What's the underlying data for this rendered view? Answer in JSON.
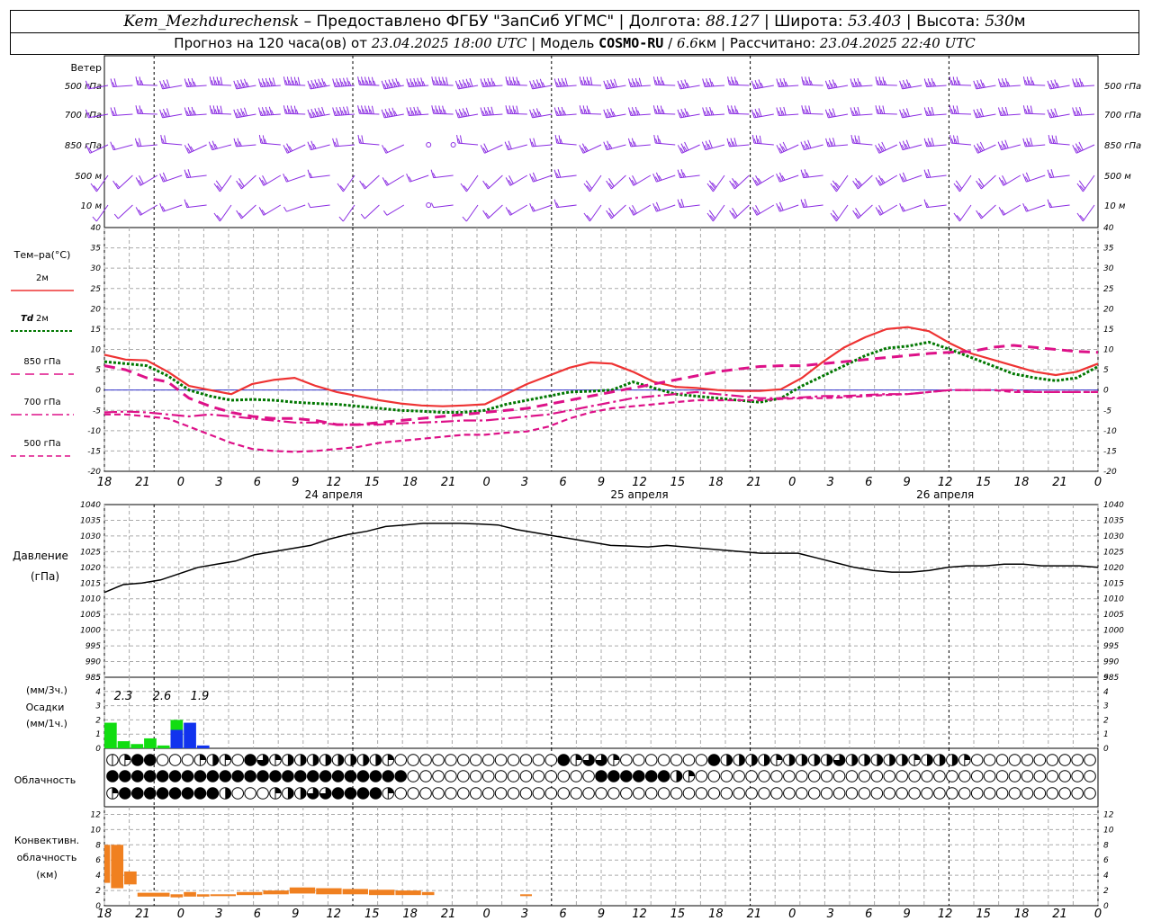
{
  "header": {
    "station": "Kem_Mezhdurechensk",
    "dash": "–",
    "provider": "Предоставлено ФГБУ \"ЗапСиб УГМС\"",
    "sep": "|",
    "lon_label": "Долгота:",
    "lon_value": "88.127",
    "lat_label": "Широта:",
    "lat_value": "53.403",
    "alt_label": "Высота:",
    "alt_value": "530",
    "alt_unit": "м",
    "forecast_prefix": "Прогноз на 120 часа(ов) от",
    "forecast_from": "23.04.2025 18:00 UTC",
    "model_label": "Модель",
    "model_name": "COSMO-RU",
    "model_res": "6.6",
    "model_res_unit": "км",
    "computed_label": "Рассчитано:",
    "computed_at": "23.04.2025 22:40 UTC"
  },
  "colors": {
    "t2m": "#ee3333",
    "td2m": "#007700",
    "upper": "#dd1188",
    "wind": "#8a2be2",
    "pressure": "#000000",
    "precip_green": "#11dd11",
    "precip_blue": "#1133ee",
    "convective": "#f08020",
    "zero_line": "#3333cc"
  },
  "time_axis": {
    "hour_labels": [
      "18",
      "21",
      "0",
      "3",
      "6",
      "9",
      "12",
      "15",
      "18",
      "21",
      "0",
      "3",
      "6",
      "9",
      "12",
      "15",
      "18",
      "21",
      "0",
      "3",
      "6",
      "9",
      "12",
      "15",
      "18",
      "21",
      "0"
    ],
    "date_labels": [
      "24 апреля",
      "25 апреля",
      "26 апреля"
    ]
  },
  "wind_panel": {
    "title": "Ветер",
    "levels": [
      "500 гПа",
      "700 гПа",
      "850 гПа",
      "500 м",
      "10 м"
    ]
  },
  "temp_panel": {
    "title": "Тем–ра(°С)",
    "legend": [
      {
        "label": "2м",
        "style": "solid"
      },
      {
        "label_td": "Td",
        "label": "2м",
        "style": "dotted"
      },
      {
        "label": "850 гПа",
        "style": "dashed"
      },
      {
        "label": "700 гПа",
        "style": "dashdot"
      },
      {
        "label": "500 гПа",
        "style": "shortdash"
      }
    ]
  },
  "pressure_panel": {
    "title": "Давление",
    "unit": "(гПа)"
  },
  "precip_panel": {
    "unit3h": "(мм/3ч.)",
    "title": "Осадки",
    "unit1h": "(мм/1ч.)",
    "totals": [
      "2.3",
      "2.6",
      "1.9"
    ]
  },
  "cloud_panel": {
    "title": "Облачность",
    "rows": [
      "01445551210431222222221000000000000041331000000042222122223222221222100000000000000000000000000000000000",
      "44444444444444444444444400000000000000044444421000000000000000000000000000000000000000000000000000000",
      "14444444420001223344441000000000000000000000000000000000000000000000000000000000000000000000000000000"
    ]
  },
  "conv_panel": {
    "title1": "Конвективн.",
    "title2": "облачность",
    "unit": "(км)"
  },
  "chart_data": [
    {
      "type": "line",
      "title": "Тем–ра(°С)",
      "ylim": [
        -20,
        40
      ],
      "x_hours_from_start": [
        0,
        1,
        3,
        6,
        9,
        12,
        15,
        18,
        21,
        24,
        27,
        30,
        33,
        36,
        39,
        42,
        45,
        48,
        51,
        54,
        57,
        60,
        63,
        66,
        69,
        72,
        75,
        78,
        81,
        84,
        87,
        90,
        93,
        96,
        99,
        102,
        105,
        108,
        111,
        114,
        117,
        120
      ],
      "series": [
        {
          "name": "2м",
          "values": [
            8.7,
            7.5,
            7.3,
            4.5,
            1,
            0,
            -1,
            1.5,
            2.5,
            3,
            1,
            -0.5,
            -1.5,
            -2.5,
            -3.3,
            -3.8,
            -4,
            -3.8,
            -3.5,
            -1,
            1.5,
            3.5,
            5.5,
            6.8,
            6.5,
            4.5,
            2,
            0.8,
            0.5,
            0,
            -0.2,
            -0.2,
            0.2,
            3,
            7,
            10.5,
            13,
            15,
            15.5,
            14.5,
            11.5,
            9,
            7.5,
            6,
            4.5,
            3.7,
            4.5,
            6.5
          ]
        },
        {
          "name": "Td 2м",
          "values": [
            7,
            6.5,
            6,
            3.5,
            0,
            -1.5,
            -2.5,
            -2.3,
            -2.5,
            -3,
            -3.3,
            -3.5,
            -4,
            -4.5,
            -5,
            -5.2,
            -5.5,
            -5.5,
            -5,
            -3.5,
            -2.5,
            -1.5,
            -0.5,
            -0.3,
            0,
            2,
            0.5,
            -1,
            -1.5,
            -2,
            -2.5,
            -3,
            -2,
            1,
            3.5,
            6,
            8.5,
            10.3,
            10.8,
            11.8,
            10,
            8,
            6,
            4,
            3,
            2.3,
            3,
            5.8
          ]
        },
        {
          "name": "850 гПа",
          "values": [
            6,
            5,
            3,
            2,
            -2,
            -4,
            -5.5,
            -6.5,
            -7,
            -7,
            -7.5,
            -8.5,
            -8.5,
            -8,
            -7.5,
            -7,
            -6.5,
            -6,
            -5.5,
            -5,
            -4.5,
            -3.5,
            -2.5,
            -1.5,
            -0.5,
            0.5,
            1.5,
            2.5,
            3.5,
            4.5,
            5.2,
            5.8,
            6,
            6,
            6.5,
            7,
            7.5,
            8,
            8.5,
            9,
            9.3,
            9.5,
            10.5,
            11,
            10.5,
            10,
            9.5,
            9.3
          ]
        },
        {
          "name": "700 гПа",
          "values": [
            -5.5,
            -5.3,
            -5.5,
            -6,
            -6.5,
            -6,
            -6.5,
            -7,
            -7.5,
            -8,
            -8,
            -8.5,
            -8.5,
            -8.5,
            -8.2,
            -8,
            -7.8,
            -7.5,
            -7.5,
            -7,
            -6.5,
            -6,
            -5,
            -4,
            -3,
            -2,
            -1.5,
            -1,
            -0.5,
            -1,
            -1.5,
            -2,
            -2,
            -1.8,
            -1.5,
            -1.5,
            -1.2,
            -1,
            -1,
            -0.5,
            0,
            0,
            0,
            0,
            -0.5,
            -0.5,
            -0.5,
            -0.5
          ]
        },
        {
          "name": "500 гПа",
          "values": [
            -6,
            -6,
            -6.5,
            -7,
            -9,
            -11,
            -13,
            -14.5,
            -15,
            -15.2,
            -15,
            -14.5,
            -14,
            -13,
            -12.5,
            -12,
            -11.5,
            -11,
            -11,
            -10.5,
            -10.2,
            -9,
            -7,
            -5.5,
            -4.5,
            -4,
            -3.5,
            -3,
            -2.5,
            -2.5,
            -2.5,
            -2.5,
            -2.2,
            -2,
            -2,
            -1.8,
            -1.5,
            -1.2,
            -1,
            -0.5,
            0,
            0,
            0,
            -0.5,
            -0.5,
            -0.5,
            -0.5,
            -0.5
          ]
        }
      ]
    },
    {
      "type": "line",
      "title": "Давление",
      "ylabel": "(гПа)",
      "ylim": [
        985,
        1040
      ],
      "x_hours_from_start": [
        0,
        1.5,
        3,
        4.5,
        6,
        7.5,
        9,
        12,
        15,
        18,
        21,
        24,
        27,
        30,
        33,
        36,
        39,
        42,
        45,
        48,
        51,
        54,
        57,
        60,
        63,
        66,
        69,
        72,
        75,
        78,
        81,
        84,
        87,
        90,
        93,
        96,
        99,
        102,
        105,
        108,
        111,
        114,
        117,
        120
      ],
      "series": [
        {
          "name": "Давление",
          "values": [
            1012,
            1014.5,
            1015,
            1016,
            1018,
            1020,
            1021,
            1022,
            1024,
            1025,
            1026,
            1027,
            1029,
            1030.5,
            1031.5,
            1033,
            1033.5,
            1034,
            1034,
            1034,
            1033.8,
            1033.5,
            1032,
            1031,
            1030,
            1029,
            1028,
            1027,
            1026.8,
            1026.5,
            1027,
            1026.5,
            1026,
            1025.5,
            1025,
            1024.5,
            1024.5,
            1024.5,
            1023,
            1021.5,
            1020,
            1019,
            1018.5,
            1018.5,
            1019,
            1020,
            1020.5,
            1020.5,
            1021,
            1021,
            1020.5,
            1020.5,
            1020.5,
            1020
          ]
        }
      ]
    },
    {
      "type": "bar",
      "title": "Осадки",
      "ylim": [
        0,
        5
      ],
      "bars": [
        {
          "start_h": 0,
          "end_h": 3,
          "value": 1.8,
          "color": "green"
        },
        {
          "start_h": 3,
          "end_h": 6,
          "value": 0.5,
          "color": "green"
        },
        {
          "start_h": 6,
          "end_h": 9,
          "value": 0.3,
          "color": "green"
        },
        {
          "start_h": 9,
          "end_h": 12,
          "value": 0.7,
          "color": "green"
        },
        {
          "start_h": 12,
          "end_h": 15,
          "value": 0.2,
          "color": "green"
        },
        {
          "start_h": 15,
          "end_h": 18,
          "value": 2.0,
          "color": "green"
        },
        {
          "start_h": 15,
          "end_h": 18,
          "value": 1.3,
          "color": "blue"
        },
        {
          "start_h": 18,
          "end_h": 21,
          "value": 1.8,
          "color": "blue"
        },
        {
          "start_h": 21,
          "end_h": 24,
          "value": 0.2,
          "color": "blue"
        }
      ]
    },
    {
      "type": "bar",
      "title": "Конвективн. облачность",
      "ylabel": "(км)",
      "ylim": [
        0,
        13
      ],
      "bars": [
        {
          "start_h": 0,
          "end_h": 1.5,
          "bottom": 3,
          "top": 8
        },
        {
          "start_h": 1.5,
          "end_h": 4.5,
          "bottom": 2.3,
          "top": 8
        },
        {
          "start_h": 4.5,
          "end_h": 7.5,
          "bottom": 2.8,
          "top": 4.5
        },
        {
          "start_h": 7.5,
          "end_h": 15,
          "bottom": 1.2,
          "top": 1.7
        },
        {
          "start_h": 15,
          "end_h": 18,
          "bottom": 1.1,
          "top": 1.5
        },
        {
          "start_h": 18,
          "end_h": 21,
          "bottom": 1.2,
          "top": 1.8
        },
        {
          "start_h": 21,
          "end_h": 24,
          "bottom": 1.2,
          "top": 1.5
        },
        {
          "start_h": 24,
          "end_h": 30,
          "bottom": 1.3,
          "top": 1.5
        },
        {
          "start_h": 30,
          "end_h": 36,
          "bottom": 1.4,
          "top": 1.8
        },
        {
          "start_h": 36,
          "end_h": 42,
          "bottom": 1.5,
          "top": 2.0
        },
        {
          "start_h": 42,
          "end_h": 48,
          "bottom": 1.6,
          "top": 2.4
        },
        {
          "start_h": 48,
          "end_h": 54,
          "bottom": 1.5,
          "top": 2.3
        },
        {
          "start_h": 54,
          "end_h": 60,
          "bottom": 1.5,
          "top": 2.2
        },
        {
          "start_h": 60,
          "end_h": 66,
          "bottom": 1.4,
          "top": 2.1
        },
        {
          "start_h": 66,
          "end_h": 72,
          "bottom": 1.4,
          "top": 2.0
        },
        {
          "start_h": 72,
          "end_h": 75,
          "bottom": 1.4,
          "top": 1.8
        }
      ]
    },
    {
      "type": "line",
      "title": "Ветер",
      "description_levels": [
        "500 гПа",
        "700 гПа",
        "850 гПа",
        "500 м",
        "10 м"
      ],
      "barb_speed_kt_by_level": [
        [
          10,
          15,
          20,
          25,
          30,
          35,
          40,
          45,
          45,
          50,
          55,
          55,
          50,
          50,
          45,
          45,
          40,
          40,
          40,
          35,
          35,
          35,
          35,
          30,
          30,
          30,
          30,
          30,
          30,
          30,
          30,
          30,
          30,
          30,
          30,
          30,
          30,
          30,
          30,
          30,
          30
        ],
        [
          10,
          15,
          20,
          25,
          30,
          35,
          35,
          40,
          40,
          45,
          45,
          45,
          40,
          40,
          40,
          35,
          35,
          35,
          30,
          30,
          30,
          30,
          30,
          30,
          30,
          30,
          30,
          25,
          25,
          25,
          25,
          25,
          25,
          25,
          25,
          25,
          25,
          25,
          25,
          25,
          25
        ],
        [
          10,
          10,
          15,
          15,
          20,
          20,
          20,
          20,
          20,
          20,
          15,
          15,
          10,
          0,
          0,
          15,
          15,
          15,
          15,
          20,
          20,
          20,
          20,
          20,
          25,
          25,
          25,
          25,
          25,
          25,
          25,
          25,
          25,
          25,
          25,
          25,
          25,
          25,
          25,
          25,
          25
        ],
        [
          10,
          10,
          15,
          15,
          15,
          15,
          15,
          15,
          10,
          10,
          10,
          10,
          10,
          10,
          10,
          10,
          10,
          15,
          15,
          15,
          15,
          15,
          15,
          20,
          20,
          20,
          20,
          20,
          20,
          20,
          20,
          20,
          20,
          15,
          15,
          15,
          15,
          15,
          15,
          15,
          15
        ],
        [
          5,
          5,
          10,
          10,
          10,
          10,
          10,
          10,
          5,
          5,
          5,
          5,
          5,
          0,
          5,
          5,
          10,
          10,
          10,
          10,
          10,
          15,
          15,
          15,
          15,
          15,
          15,
          15,
          15,
          15,
          15,
          15,
          15,
          10,
          10,
          10,
          10,
          10,
          10,
          10,
          10
        ]
      ]
    }
  ]
}
